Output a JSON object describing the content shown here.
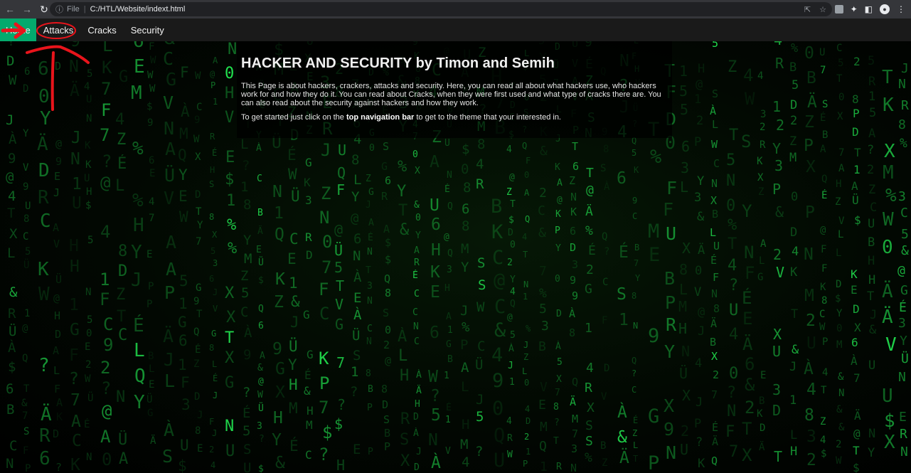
{
  "browser": {
    "address_scheme": "File",
    "address_url": "C:/HTL/Website/indext.html"
  },
  "nav": {
    "items": [
      {
        "label": "Home",
        "active": true
      },
      {
        "label": "Attacks",
        "active": false
      },
      {
        "label": "Cracks",
        "active": false
      },
      {
        "label": "Security",
        "active": false
      }
    ]
  },
  "content": {
    "title": "HACKER AND SECURITY by Timon and Semih",
    "intro": "This Page is about hackers, crackers, attacks and security. Here, you can read all about what hackers use, who hackers work for and how they do it. You can read about Cracks, when they were first used and what type of cracks there are. You can also read about the security against hackers and how they work.",
    "cta_before": "To get started just click on the ",
    "cta_bold": "top navigation bar",
    "cta_after": " to get to the theme that your interested in."
  },
  "colors": {
    "accent": "#04aa6d",
    "annotation": "#e8141b",
    "matrix_green": "#22e05a"
  }
}
